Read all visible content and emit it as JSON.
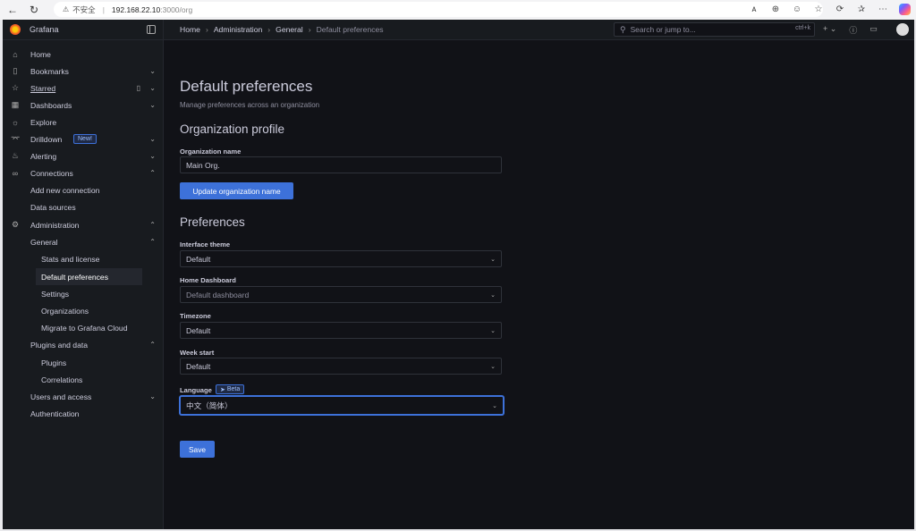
{
  "browser": {
    "warning": "⚠",
    "insecure_label": "不安全",
    "url_host": "192.168.22.10",
    "url_path": ":3000/org"
  },
  "sidebar": {
    "brand": "Grafana",
    "items": [
      {
        "label": "Home"
      },
      {
        "label": "Bookmarks"
      },
      {
        "label": "Starred"
      },
      {
        "label": "Dashboards"
      },
      {
        "label": "Explore"
      },
      {
        "label": "Drilldown",
        "badge": "New!"
      },
      {
        "label": "Alerting"
      },
      {
        "label": "Connections"
      },
      {
        "label": "Add new connection"
      },
      {
        "label": "Data sources"
      },
      {
        "label": "Administration"
      },
      {
        "label": "General"
      },
      {
        "label": "Stats and license"
      },
      {
        "label": "Default preferences"
      },
      {
        "label": "Settings"
      },
      {
        "label": "Organizations"
      },
      {
        "label": "Migrate to Grafana Cloud"
      },
      {
        "label": "Plugins and data"
      },
      {
        "label": "Plugins"
      },
      {
        "label": "Correlations"
      },
      {
        "label": "Users and access"
      },
      {
        "label": "Authentication"
      }
    ]
  },
  "topbar": {
    "breadcrumbs": [
      "Home",
      "Administration",
      "General",
      "Default preferences"
    ],
    "search_placeholder": "Search or jump to...",
    "search_shortcut": "ctrl+k"
  },
  "main": {
    "title": "Default preferences",
    "subtitle": "Manage preferences across an organization",
    "org_profile_title": "Organization profile",
    "org_name_label": "Organization name",
    "org_name_value": "Main Org.",
    "update_button": "Update organization name",
    "preferences_title": "Preferences",
    "theme_label": "Interface theme",
    "theme_value": "Default",
    "home_dashboard_label": "Home Dashboard",
    "home_dashboard_placeholder": "Default dashboard",
    "timezone_label": "Timezone",
    "timezone_value": "Default",
    "week_start_label": "Week start",
    "week_start_value": "Default",
    "language_label": "Language",
    "language_badge": "Beta",
    "language_value": "中文（简体）",
    "save_button": "Save"
  },
  "colors": {
    "accent": "#3d71d9",
    "active_indicator": "#f55f3e",
    "background": "#111217",
    "sidebar_bg": "#181b1f"
  }
}
